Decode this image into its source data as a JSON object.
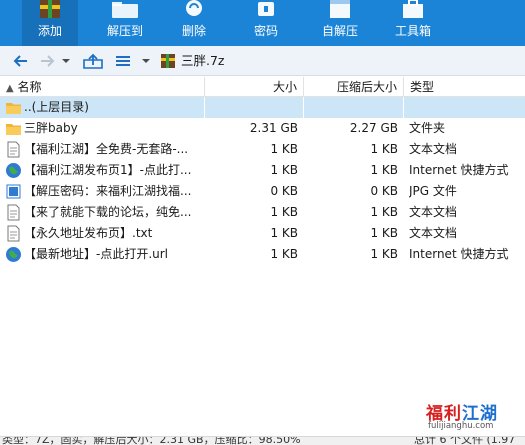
{
  "toolbar": {
    "add_label": "添加",
    "extract_label": "解压到",
    "delete_label": "删除",
    "password_label": "密码",
    "auto_extract_label": "自解压",
    "tools_label": "工具箱"
  },
  "address": {
    "path": "三胖.7z"
  },
  "columns": {
    "name": "名称",
    "size": "大小",
    "packed": "压缩后大小",
    "type": "类型"
  },
  "files": [
    {
      "name": "..(上层目录)",
      "size": "",
      "packed": "",
      "type": "",
      "icon": "folder-icon"
    },
    {
      "name": "三胖baby",
      "size": "2.31 GB",
      "packed": "2.27 GB",
      "type": "文件夹",
      "icon": "folder-icon"
    },
    {
      "name": "【福利江湖】全免费-无套路-...",
      "size": "1 KB",
      "packed": "1 KB",
      "type": "文本文档",
      "icon": "text-file-icon"
    },
    {
      "name": "【福利江湖发布页1】-点此打...",
      "size": "1 KB",
      "packed": "1 KB",
      "type": "Internet 快捷方式",
      "icon": "globe-icon"
    },
    {
      "name": "【解压密码：来福利江湖找福...",
      "size": "0 KB",
      "packed": "0 KB",
      "type": "JPG 文件",
      "icon": "image-file-icon"
    },
    {
      "name": "【来了就能下载的论坛，纯免...",
      "size": "1 KB",
      "packed": "1 KB",
      "type": "文本文档",
      "icon": "text-file-icon"
    },
    {
      "name": "【永久地址发布页】.txt",
      "size": "1 KB",
      "packed": "1 KB",
      "type": "文本文档",
      "icon": "text-file-icon"
    },
    {
      "name": "【最新地址】-点此打开.url",
      "size": "1 KB",
      "packed": "1 KB",
      "type": "Internet 快捷方式",
      "icon": "globe-icon"
    }
  ],
  "watermark": {
    "title_part1": "福利",
    "title_part2": "江湖",
    "url": "fulijianghu.com"
  },
  "status": {
    "left": "类型：7Z，固实，解压后大小：2.31 GB，压缩比：98.50%",
    "right": "总计 6 个文件 (1.97"
  }
}
